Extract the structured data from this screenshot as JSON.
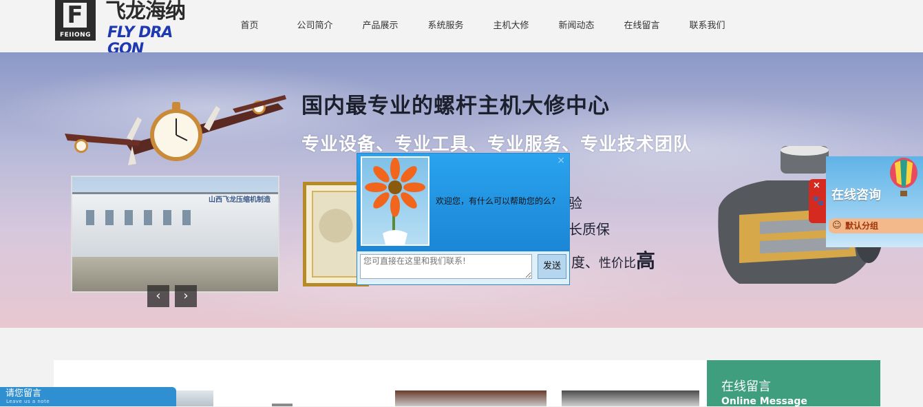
{
  "logo": {
    "letter": "F",
    "sub": "FEIIONG",
    "cn": "飞龙海纳",
    "en": "FLY DRA GON"
  },
  "nav": {
    "items": [
      "首页",
      "公司简介",
      "产品展示",
      "系统服务",
      "主机大修",
      "新闻动态",
      "在线留言",
      "联系我们"
    ]
  },
  "banner": {
    "headline": "国内最专业的螺杆主机大修中心",
    "subheadline": "专业设备、专业工具、专业服务、专业技术团队",
    "feature_1": "验",
    "feature_2": "长质保",
    "feature_3_a": "度、",
    "feature_3_b": "性价比",
    "feature_3_c": "高",
    "factory_sign": "山西飞龙压缩机制造",
    "prev_arrow": "‹",
    "next_arrow": "›"
  },
  "chat": {
    "close": "×",
    "message": "欢迎您，有什么可以帮助您的么?",
    "placeholder": "您可直接在这里和我们联系!",
    "send": "发送"
  },
  "consult": {
    "close": "×",
    "paw": "🐾",
    "title": "在线咨询",
    "group_icon": "☺",
    "group_label": "默认分组"
  },
  "online_message": {
    "title": "在线留言",
    "subtitle": "Online Message"
  },
  "note": {
    "title": "请您留言",
    "subtitle": "Leave us a note"
  },
  "colors": {
    "brand_blue": "#1f3ab0",
    "chat_blue": "#1d90dc",
    "online_green": "#3f9e7e",
    "note_blue": "#2f8fd0",
    "consult_red": "#d52a20"
  }
}
